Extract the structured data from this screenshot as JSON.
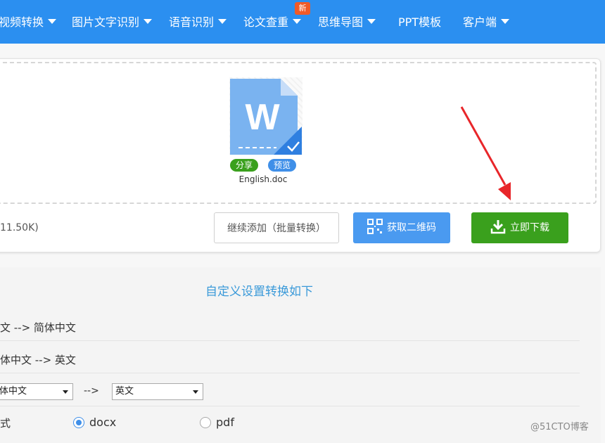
{
  "nav": {
    "items": [
      {
        "label": "视频转换"
      },
      {
        "label": "图片文字识别"
      },
      {
        "label": "语音识别"
      },
      {
        "label": "论文查重"
      },
      {
        "label": "思维导图"
      },
      {
        "label": "PPT模板"
      },
      {
        "label": "客户端"
      }
    ],
    "new_badge": "新"
  },
  "upload": {
    "file_name": "English.doc",
    "file_icon": "word-document-icon",
    "share_label": "分享",
    "preview_label": "预览",
    "size_text": "11.50K)",
    "continue_label": "继续添加（批量转换）",
    "qr_label": "获取二维码",
    "download_label": "立即下载"
  },
  "settings": {
    "title": "自定义设置转换如下",
    "row1": "文 --> 简体中文",
    "row2": "体中文 --> 英文",
    "source_select": "体中文",
    "arrow_text": "-->",
    "target_select": "英文",
    "format_label": "式",
    "format_options": [
      {
        "label": "docx",
        "selected": true
      },
      {
        "label": "pdf",
        "selected": false
      }
    ]
  },
  "watermark": "@51CTO博客",
  "colors": {
    "nav_bg": "#2b8ff0",
    "new_badge": "#f05a28",
    "green": "#3aa01d",
    "blue": "#4a9af0",
    "title_blue": "#3b9ad9",
    "arrow_red": "#e8262a"
  }
}
